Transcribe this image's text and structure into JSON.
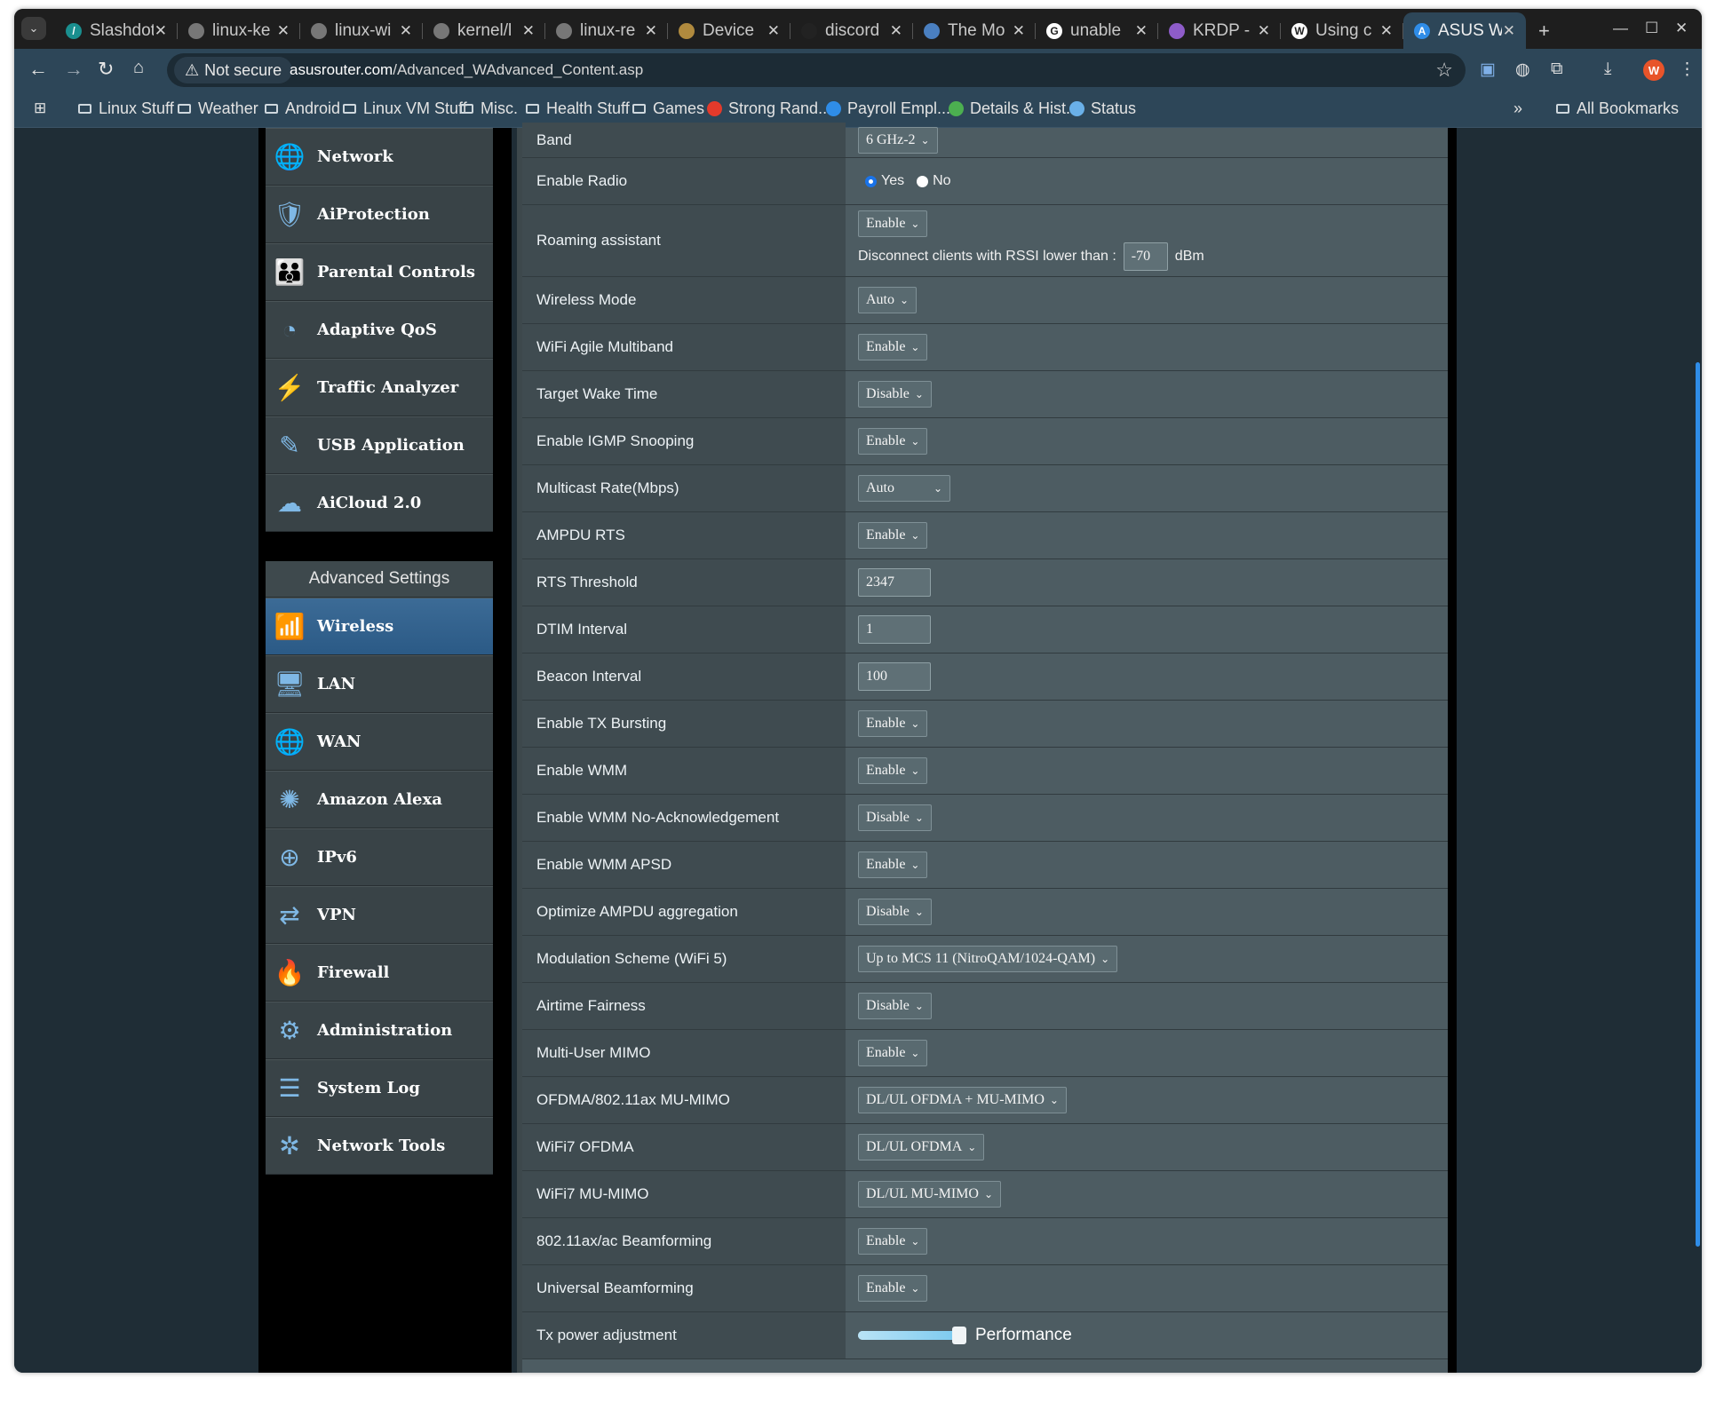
{
  "browser": {
    "tabs": [
      {
        "title": "Slashdot",
        "icon": "slashdot-icon",
        "color": "#1a8f8f",
        "glyph": "/"
      },
      {
        "title": "linux-ke",
        "icon": "globe-icon",
        "color": "#777777",
        "glyph": ""
      },
      {
        "title": "linux-wi",
        "icon": "globe-icon",
        "color": "#777777",
        "glyph": ""
      },
      {
        "title": "kernel/l",
        "icon": "globe-icon",
        "color": "#777777",
        "glyph": ""
      },
      {
        "title": "linux-re",
        "icon": "globe-icon",
        "color": "#777777",
        "glyph": ""
      },
      {
        "title": "Device",
        "icon": "device-icon",
        "color": "#b08a3e",
        "glyph": ""
      },
      {
        "title": "discord",
        "icon": "github-icon",
        "color": "#222222",
        "glyph": ""
      },
      {
        "title": "The Mo",
        "icon": "shield-icon",
        "color": "#4a7fc0",
        "glyph": ""
      },
      {
        "title": "unable",
        "icon": "google-icon",
        "color": "#ffffff",
        "glyph": "G"
      },
      {
        "title": "KRDP -",
        "icon": "krdp-icon",
        "color": "#8e5cc9",
        "glyph": ""
      },
      {
        "title": "Using c",
        "icon": "wiki-icon",
        "color": "#ffffff",
        "glyph": "W"
      },
      {
        "title": "ASUS W",
        "icon": "asus-icon",
        "color": "#2f8de8",
        "glyph": "A"
      }
    ],
    "not_secure": "Not secure",
    "url_host": "asusrouter.com",
    "url_path": "/Advanced_WAdvanced_Content.asp",
    "profile_initial": "W",
    "bookmarks": [
      {
        "label": "Linux Stuff",
        "type": "folder"
      },
      {
        "label": "Weather",
        "type": "folder"
      },
      {
        "label": "Android",
        "type": "folder"
      },
      {
        "label": "Linux VM Stuff",
        "type": "folder"
      },
      {
        "label": "Misc.",
        "type": "folder"
      },
      {
        "label": "Health Stuff",
        "type": "folder"
      },
      {
        "label": "Games",
        "type": "folder"
      },
      {
        "label": "Strong Rand...",
        "type": "link",
        "color": "#e33a2b"
      },
      {
        "label": "Payroll Empl...",
        "type": "link",
        "color": "#2f8de8"
      },
      {
        "label": "Details & Hist...",
        "type": "link",
        "color": "#4caf50"
      },
      {
        "label": "Status",
        "type": "link",
        "color": "#6ab0e8"
      }
    ],
    "overflow": "»",
    "all_bookmarks": "All Bookmarks"
  },
  "sidebar": {
    "top_items": [
      {
        "label": "Network",
        "icon": "network-icon"
      },
      {
        "label": "AiProtection",
        "icon": "aiprotection-icon"
      },
      {
        "label": "Parental Controls",
        "icon": "parental-controls-icon"
      },
      {
        "label": "Adaptive QoS",
        "icon": "qos-icon"
      },
      {
        "label": "Traffic Analyzer",
        "icon": "traffic-analyzer-icon"
      },
      {
        "label": "USB Application",
        "icon": "usb-icon"
      },
      {
        "label": "AiCloud 2.0",
        "icon": "cloud-icon"
      }
    ],
    "advanced_header": "Advanced Settings",
    "advanced_items": [
      {
        "label": "Wireless",
        "icon": "wireless-icon",
        "active": true
      },
      {
        "label": "LAN",
        "icon": "lan-icon"
      },
      {
        "label": "WAN",
        "icon": "wan-icon"
      },
      {
        "label": "Amazon Alexa",
        "icon": "alexa-icon"
      },
      {
        "label": "IPv6",
        "icon": "ipv6-icon"
      },
      {
        "label": "VPN",
        "icon": "vpn-icon"
      },
      {
        "label": "Firewall",
        "icon": "firewall-icon"
      },
      {
        "label": "Administration",
        "icon": "administration-icon"
      },
      {
        "label": "System Log",
        "icon": "system-log-icon"
      },
      {
        "label": "Network Tools",
        "icon": "network-tools-icon"
      }
    ]
  },
  "settings": [
    {
      "label": "Band",
      "type": "select",
      "value": "6 GHz-2"
    },
    {
      "label": "Enable Radio",
      "type": "radio",
      "options": [
        "Yes",
        "No"
      ],
      "selected": "Yes"
    },
    {
      "label": "Roaming assistant",
      "type": "roaming",
      "value": "Enable",
      "sub_label": "Disconnect clients with RSSI lower than :",
      "sub_value": "-70",
      "unit": "dBm"
    },
    {
      "label": "Wireless Mode",
      "type": "select",
      "value": "Auto"
    },
    {
      "label": "WiFi Agile Multiband",
      "type": "select",
      "value": "Enable"
    },
    {
      "label": "Target Wake Time",
      "type": "select",
      "value": "Disable"
    },
    {
      "label": "Enable IGMP Snooping",
      "type": "select",
      "value": "Enable"
    },
    {
      "label": "Multicast Rate(Mbps)",
      "type": "select",
      "value": "Auto",
      "wide": true
    },
    {
      "label": "AMPDU RTS",
      "type": "select",
      "value": "Enable"
    },
    {
      "label": "RTS Threshold",
      "type": "input",
      "value": "2347"
    },
    {
      "label": "DTIM Interval",
      "type": "input",
      "value": "1"
    },
    {
      "label": "Beacon Interval",
      "type": "input",
      "value": "100"
    },
    {
      "label": "Enable TX Bursting",
      "type": "select",
      "value": "Enable"
    },
    {
      "label": "Enable WMM",
      "type": "select",
      "value": "Enable"
    },
    {
      "label": "Enable WMM No-Acknowledgement",
      "type": "select",
      "value": "Disable"
    },
    {
      "label": "Enable WMM APSD",
      "type": "select",
      "value": "Enable"
    },
    {
      "label": "Optimize AMPDU aggregation",
      "type": "select",
      "value": "Disable"
    },
    {
      "label": "Modulation Scheme (WiFi 5)",
      "type": "select",
      "value": "Up to MCS 11 (NitroQAM/1024-QAM)"
    },
    {
      "label": "Airtime Fairness",
      "type": "select",
      "value": "Disable"
    },
    {
      "label": "Multi-User MIMO",
      "type": "select",
      "value": "Enable"
    },
    {
      "label": "OFDMA/802.11ax MU-MIMO",
      "type": "select",
      "value": "DL/UL OFDMA + MU-MIMO"
    },
    {
      "label": "WiFi7 OFDMA",
      "type": "select",
      "value": "DL/UL OFDMA"
    },
    {
      "label": "WiFi7 MU-MIMO",
      "type": "select",
      "value": "DL/UL MU-MIMO"
    },
    {
      "label": "802.11ax/ac Beamforming",
      "type": "select",
      "value": "Enable"
    },
    {
      "label": "Universal Beamforming",
      "type": "select",
      "value": "Enable"
    },
    {
      "label": "Tx power adjustment",
      "type": "slider",
      "value": "Performance",
      "level": 1.0
    }
  ]
}
